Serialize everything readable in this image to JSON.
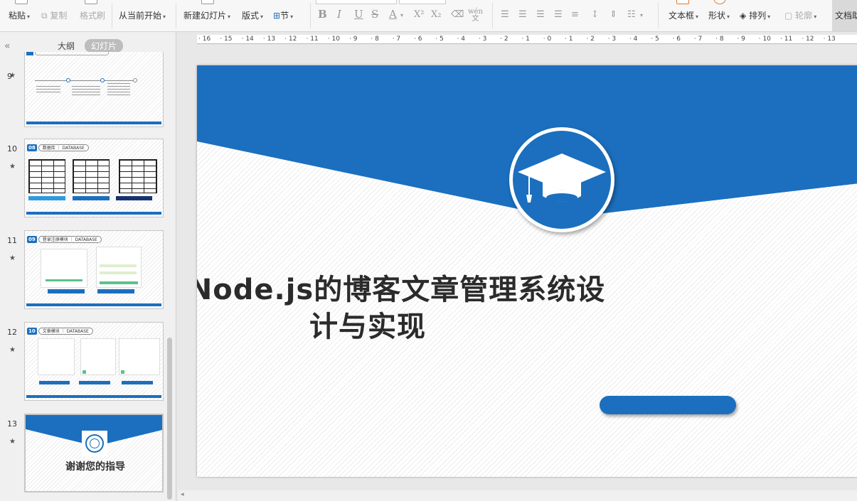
{
  "ribbon": {
    "paste": "粘贴",
    "copy": "复制",
    "format_painter": "格式刷",
    "from_current": "从当前开始",
    "new_slide": "新建幻灯片",
    "layout": "版式",
    "section": "节",
    "textbox": "文本框",
    "shape": "形状",
    "arrange": "排列",
    "outline": "轮廓",
    "doc_tools": "文档助"
  },
  "panel": {
    "tab_outline": "大纲",
    "tab_slides": "幻灯片",
    "slides": [
      {
        "num": "9"
      },
      {
        "num": "10",
        "tag_num": "08",
        "tag_label": "数据库 ｜ DATABASE"
      },
      {
        "num": "11",
        "tag_num": "09",
        "tag_label": "登录注册模块 ｜ DATABASE"
      },
      {
        "num": "12",
        "tag_num": "10",
        "tag_label": "文章模块 ｜ DATABASE"
      },
      {
        "num": "13",
        "text": "谢谢您的指导"
      }
    ]
  },
  "ruler": {
    "labels": [
      "16",
      "15",
      "14",
      "13",
      "12",
      "11",
      "10",
      "9",
      "8",
      "7",
      "6",
      "5",
      "4",
      "3",
      "2",
      "1",
      "0",
      "1",
      "2",
      "3",
      "4",
      "5",
      "6",
      "7",
      "8",
      "9",
      "10",
      "11",
      "12",
      "13"
    ]
  },
  "slide": {
    "title": "基于Node.js的博客文章管理系统设计与实现"
  },
  "colors": {
    "brand_blue": "#1b6fbe"
  }
}
